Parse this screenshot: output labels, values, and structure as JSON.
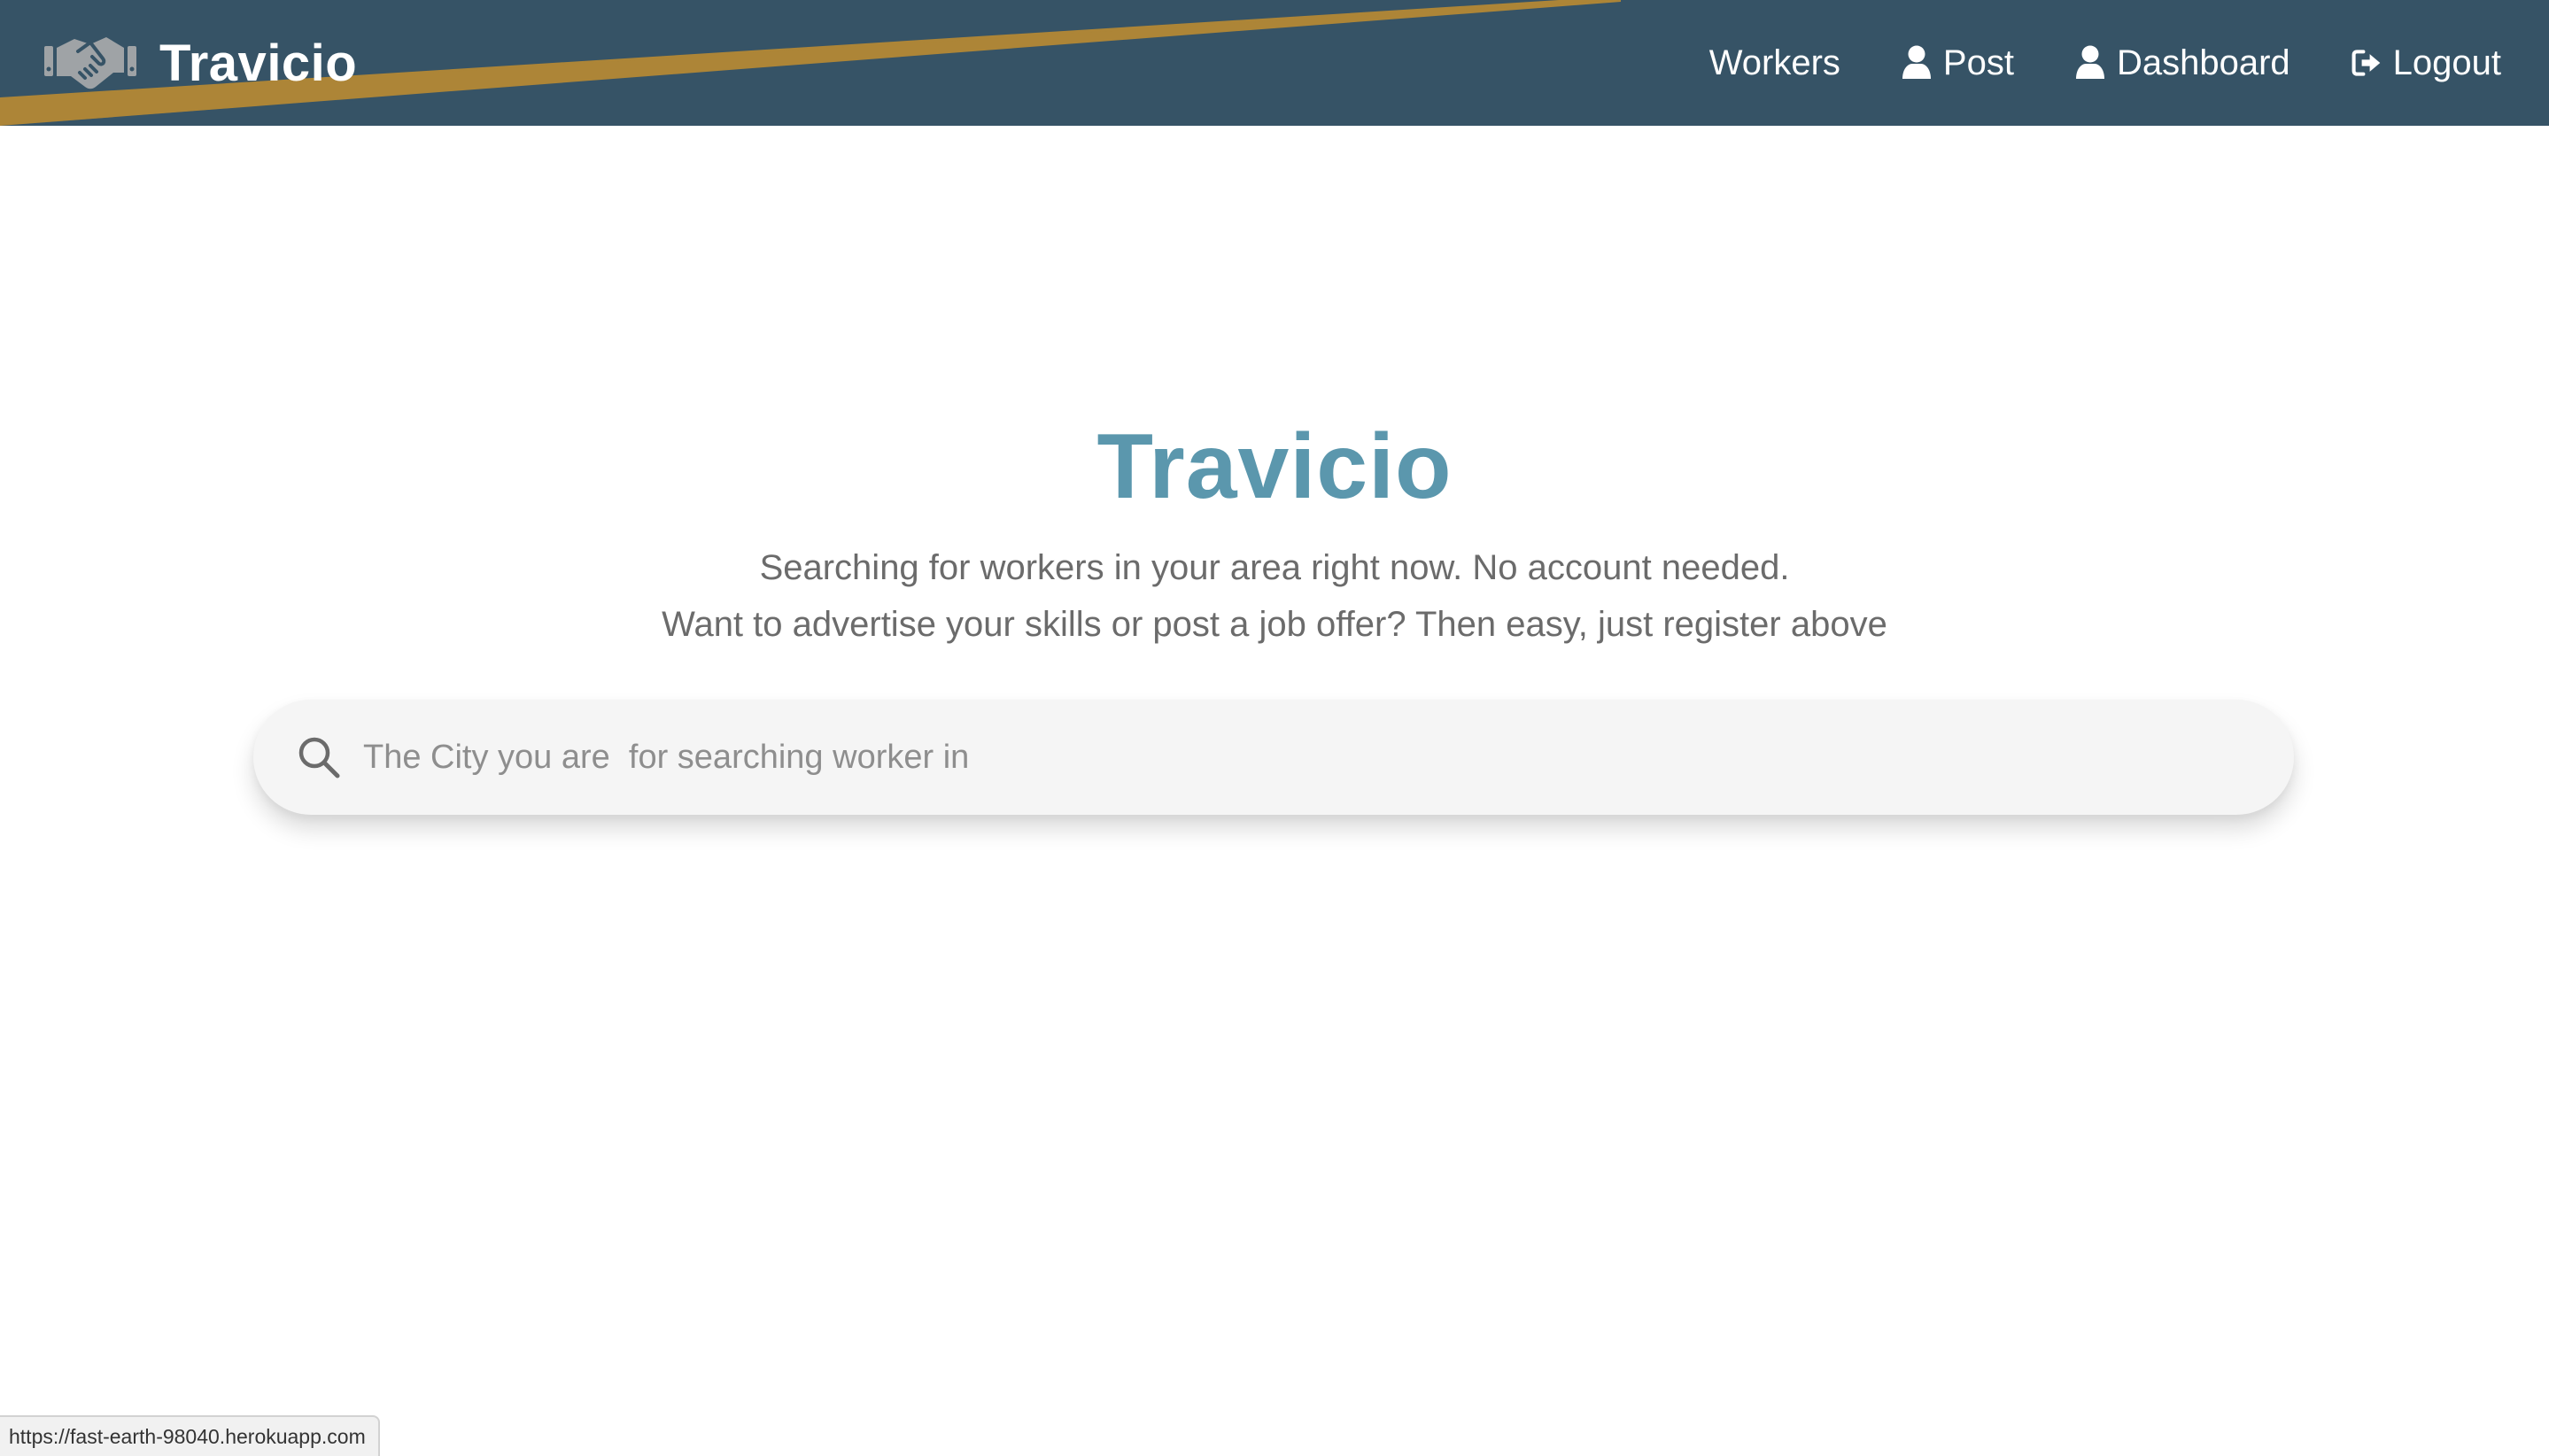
{
  "navbar": {
    "brand": "Travicio",
    "links": [
      {
        "label": "Workers",
        "icon": null
      },
      {
        "label": "Post",
        "icon": "user-icon"
      },
      {
        "label": "Dashboard",
        "icon": "user-icon"
      },
      {
        "label": "Logout",
        "icon": "sign-out-icon"
      }
    ],
    "logo_icon": "handshake-icon"
  },
  "hero": {
    "title": "Travicio",
    "subtitle_line1": "Searching for workers in your area right now. No account needed.",
    "subtitle_line2": "Want to advertise your skills or post a job offer? Then easy, just register above"
  },
  "search": {
    "placeholder": "The City you are  for searching worker in",
    "value": "",
    "icon": "search-icon"
  },
  "status_bar": {
    "url": "https://fast-earth-98040.herokuapp.com"
  },
  "colors": {
    "navbar_bg": "#365366",
    "navbar_stripe": "#ad8537",
    "hero_title": "#5b97ad",
    "subtitle_text": "#6b6b6b",
    "search_bg": "#f5f5f5"
  }
}
